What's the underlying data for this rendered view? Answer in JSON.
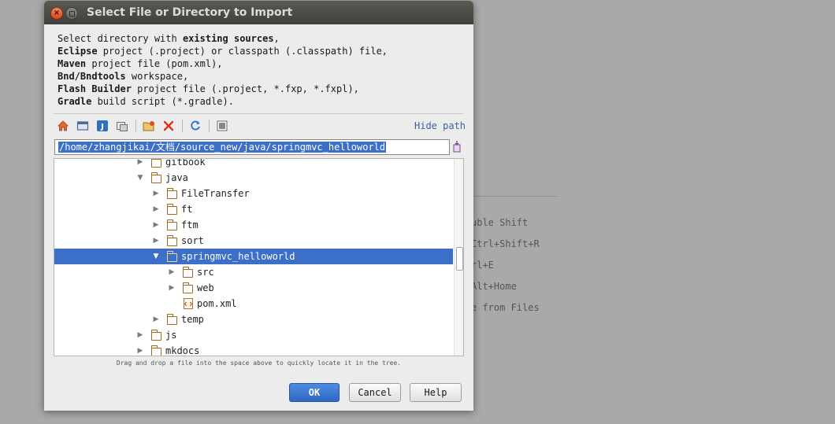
{
  "background": {
    "hints": [
      "uble Shift",
      "Ctrl+Shift+R",
      "rl+E",
      "Alt+Home",
      "e from Files"
    ]
  },
  "dialog": {
    "title": "Select File or Directory to Import",
    "window_controls": {
      "close_icon": "close-icon",
      "restore_icon": "restore-icon"
    },
    "description": [
      {
        "bold": "",
        "text": "Select directory with ",
        "bold2": "existing sources",
        "tail": ","
      },
      {
        "bold": "Eclipse",
        "text": " project (.project) or classpath (.classpath) file,",
        "bold2": "",
        "tail": ""
      },
      {
        "bold": "Maven",
        "text": " project file (pom.xml),",
        "bold2": "",
        "tail": ""
      },
      {
        "bold": "Bnd/Bndtools",
        "text": " workspace,",
        "bold2": "",
        "tail": ""
      },
      {
        "bold": "Flash Builder",
        "text": " project file (.project, *.fxp, *.fxpl),",
        "bold2": "",
        "tail": ""
      },
      {
        "bold": "Gradle",
        "text": " build script (*.gradle).",
        "bold2": "",
        "tail": ""
      }
    ],
    "toolbar": {
      "icons": [
        "home-icon",
        "desktop-icon",
        "project-icon",
        "module-icon",
        "new-folder-icon",
        "delete-icon",
        "refresh-icon",
        "show-hidden-icon"
      ],
      "hide_path": "Hide path"
    },
    "path": "/home/zhangjikai/文档/source_new/java/springmvc_helloworld",
    "tree": [
      {
        "label": "gitbook",
        "depth": 0,
        "expanded": false,
        "type": "folder"
      },
      {
        "label": "java",
        "depth": 0,
        "expanded": true,
        "type": "folder"
      },
      {
        "label": "FileTransfer",
        "depth": 1,
        "expanded": false,
        "type": "folder"
      },
      {
        "label": "ft",
        "depth": 1,
        "expanded": false,
        "type": "folder"
      },
      {
        "label": "ftm",
        "depth": 1,
        "expanded": false,
        "type": "folder"
      },
      {
        "label": "sort",
        "depth": 1,
        "expanded": false,
        "type": "folder"
      },
      {
        "label": "springmvc_helloworld",
        "depth": 1,
        "expanded": true,
        "type": "folder",
        "selected": true
      },
      {
        "label": "src",
        "depth": 2,
        "expanded": false,
        "type": "folder"
      },
      {
        "label": "web",
        "depth": 2,
        "expanded": false,
        "type": "folder"
      },
      {
        "label": "pom.xml",
        "depth": 2,
        "type": "file"
      },
      {
        "label": "temp",
        "depth": 1,
        "expanded": false,
        "type": "folder"
      },
      {
        "label": "js",
        "depth": 0,
        "expanded": false,
        "type": "folder"
      },
      {
        "label": "mkdocs",
        "depth": 0,
        "expanded": false,
        "type": "folder"
      }
    ],
    "drag_hint": "Drag and drop a file into the space above to quickly locate it in the tree.",
    "buttons": {
      "ok": "OK",
      "cancel": "Cancel",
      "help": "Help"
    }
  }
}
